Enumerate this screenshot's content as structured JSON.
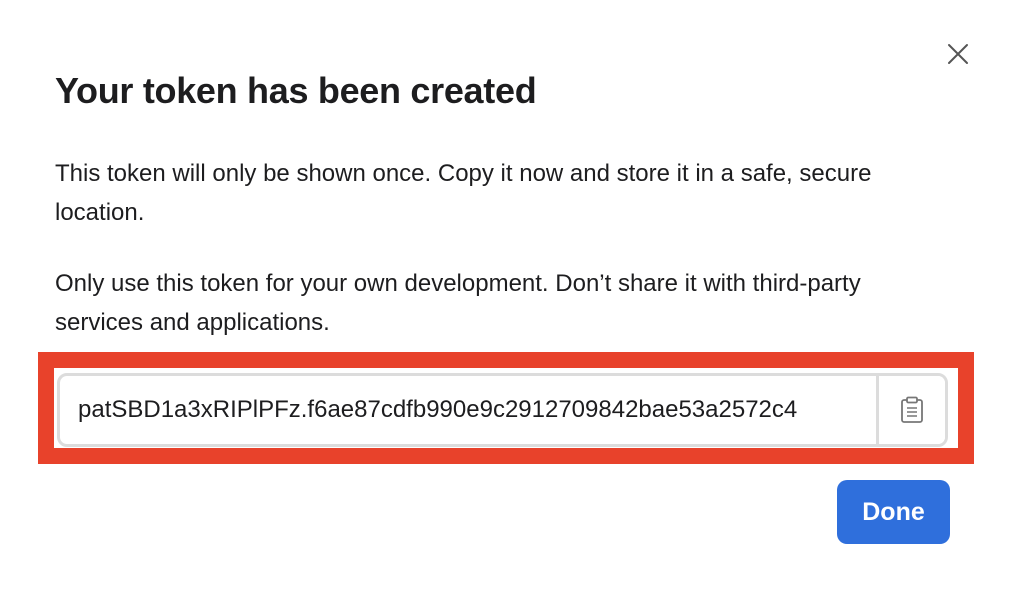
{
  "dialog": {
    "title": "Your token has been created",
    "paragraph_1": "This token will only be shown once. Copy it now and store it in a safe, secure location.",
    "paragraph_2": "Only use this token for your own development. Don’t share it with third-party services and applications.",
    "token_value": "patSBD1a3xRIPlPFz.f6ae87cdfb990e9c2912709842bae53a2572c4",
    "done_label": "Done",
    "icons": {
      "close": "close-icon",
      "copy": "clipboard-icon"
    },
    "colors": {
      "primary_button": "#2f6fdc",
      "highlight_border": "#e8422b",
      "field_border": "#dcdcdc"
    }
  }
}
